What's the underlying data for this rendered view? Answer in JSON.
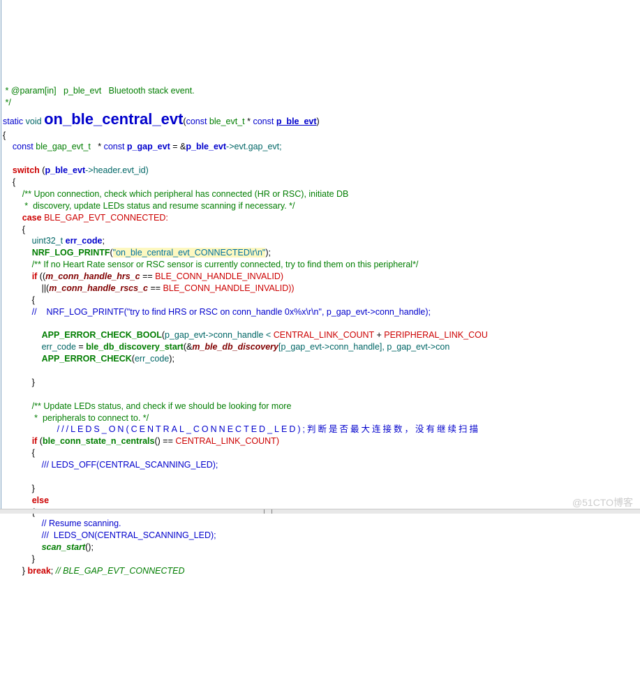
{
  "code": {
    "l01a": " * @param[in]   p_ble_evt   Bluetooth stack event.",
    "l01b": " */",
    "l02_static": "static",
    "l02_void": " void ",
    "l02_fname": "on_ble_central_evt",
    "l02_open": "(",
    "l02_const1": "const",
    "l02_type1": " ble_evt_t ",
    "l02_ptr": "* ",
    "l02_const2": "const ",
    "l02_param": "p_ble_evt",
    "l02_close": ")",
    "l03": "{",
    "l04_const": "    const",
    "l04_type": " ble_gap_evt_t   ",
    "l04_ptr": "* ",
    "l04_const2": "const ",
    "l04_var": "p_gap_evt",
    "l04_eq": " = &",
    "l04_ref": "p_ble_evt",
    "l04_deref": "->evt.gap_evt;",
    "l06_sw": "    switch",
    "l06_open": " (",
    "l06_var": "p_ble_evt",
    "l06_field": "->header.evt_id)",
    "l07": "    {",
    "l08a": "        /** Upon connection, check which peripheral has connected (HR or RSC), initiate DB",
    "l08b": "         *  discovery, update LEDs status and resume scanning if necessary. */",
    "l09_case": "        case",
    "l09_val": " BLE_GAP_EVT_CONNECTED:",
    "l10": "        {",
    "l11_type": "            uint32_t ",
    "l11_var": "err_code",
    "l11_semi": ";",
    "l12_sp": "            ",
    "l12_fn": "NRF_LOG_PRINTF",
    "l12_open": "(",
    "l12_str": "\"on_ble_central_evt_CONNECTED\\r\\n\"",
    "l12_close": ");",
    "l13": "            /** If no Heart Rate sensor or RSC sensor is currently connected, try to find them on this peripheral*/",
    "l14_sp": "            ",
    "l14_if": "if",
    "l14_open": " ((",
    "l14_v1": "m_conn_handle_hrs_c",
    "l14_eq": " == ",
    "l14_enum": "BLE_CONN_HANDLE_INVALID)",
    "l15_sp": "                ||(",
    "l15_v1": "m_conn_handle_rscs_c",
    "l15_eq": " == ",
    "l15_enum": "BLE_CONN_HANDLE_INVALID))",
    "l16": "            {",
    "l17": "            //    NRF_LOG_PRINTF(\"try to find HRS or RSC on conn_handle 0x%x\\r\\n\", p_gap_evt->conn_handle);",
    "l19_sp": "                ",
    "l19_fn": "APP_ERROR_CHECK_BOOL",
    "l19_open": "(",
    "l19_arg1": "p_gap_evt->conn_handle < ",
    "l19_c1": "CENTRAL_LINK_COUNT",
    "l19_plus": " + ",
    "l19_c2": "PERIPHERAL_LINK_COU",
    "l20_sp": "                ",
    "l20_ec": "err_code",
    "l20_eq": " = ",
    "l20_fn": "ble_db_discovery_start",
    "l20_open": "(&",
    "l20_arr": "m_ble_db_discovery",
    "l20_idx": "[p_gap_evt->conn_handle], p_gap_evt->con",
    "l21_sp": "                ",
    "l21_fn": "APP_ERROR_CHECK",
    "l21_open": "(",
    "l21_arg": "err_code",
    "l21_close": ");",
    "l23": "            }",
    "l25a": "            /** Update LEDs status, and check if we should be looking for more",
    "l25b": "             *  peripherals to connect to. */",
    "l26": "            ///LEDS_ON(CENTRAL_CONNECTED_LED);判断是否最大连接数，没有继续扫描",
    "l27_sp": "            ",
    "l27_if": "if",
    "l27_open": " (",
    "l27_fn": "ble_conn_state_n_centrals",
    "l27_call": "() == ",
    "l27_enum": "CENTRAL_LINK_COUNT)",
    "l28": "            {",
    "l29": "                /// LEDS_OFF(CENTRAL_SCANNING_LED);",
    "l31": "            }",
    "l32_sp": "            ",
    "l32_else": "else",
    "l33": "            {",
    "l34": "                // Resume scanning.",
    "l35": "                ///  LEDS_ON(CENTRAL_SCANNING_LED);",
    "l36_sp": "                ",
    "l36_fn": "scan_start",
    "l36_call": "();",
    "l37": "            }",
    "l38_sp": "        } ",
    "l38_brk": "break",
    "l38_semi": "; ",
    "l38_cmt": "// BLE_GAP_EVT_CONNECTED"
  },
  "watermark": "@51CTO博客"
}
